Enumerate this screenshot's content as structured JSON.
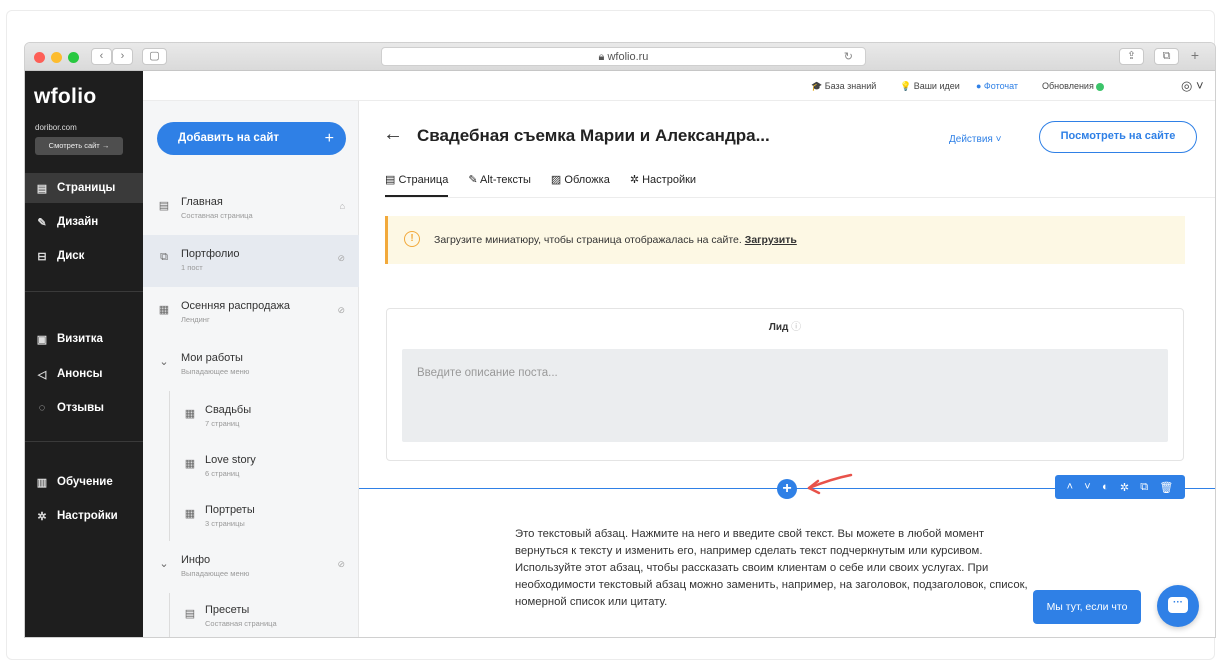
{
  "browser": {
    "url": "wfolio.ru",
    "back": "‹",
    "forward": "›",
    "sidebar_toggle": "▢",
    "share": "⇪",
    "tabs_btn": "⧉",
    "new_tab": "+"
  },
  "app": {
    "logo": "wfolio",
    "domain": "doribor.com",
    "view_site_btn": "Смотреть сайт →"
  },
  "sidebar": {
    "items": [
      {
        "label": "Страницы",
        "icon": "page-icon",
        "glyph": "▤"
      },
      {
        "label": "Дизайн",
        "icon": "brush-icon",
        "glyph": "✎"
      },
      {
        "label": "Диск",
        "icon": "disk-icon",
        "glyph": "⊟"
      },
      {
        "label": "Визитка",
        "icon": "card-icon",
        "glyph": "▣"
      },
      {
        "label": "Анонсы",
        "icon": "megaphone-icon",
        "glyph": "◁"
      },
      {
        "label": "Отзывы",
        "icon": "reviews-icon",
        "glyph": "◌"
      },
      {
        "label": "Обучение",
        "icon": "book-icon",
        "glyph": "▥"
      },
      {
        "label": "Настройки",
        "icon": "gear-icon",
        "glyph": "✲"
      }
    ]
  },
  "header": {
    "knowledge": "🎓 База знаний",
    "ideas": "💡 Ваши идеи",
    "fotochat": "● Фоточат",
    "updates": "Обновления",
    "user": "◎ ˅"
  },
  "pages_panel": {
    "add_button": "Добавить на сайт",
    "add_plus": "+",
    "items": [
      {
        "title": "Главная",
        "subtitle": "Составная страница"
      },
      {
        "title": "Портфолио",
        "subtitle": "1 пост"
      },
      {
        "title": "Осенняя распродажа",
        "subtitle": "Лендинг"
      },
      {
        "title": "Мои работы",
        "subtitle": "Выпадающее меню"
      },
      {
        "title": "Свадьбы",
        "subtitle": "7 страниц"
      },
      {
        "title": "Love story",
        "subtitle": "6 страниц"
      },
      {
        "title": "Портреты",
        "subtitle": "3 страницы"
      },
      {
        "title": "Инфо",
        "subtitle": "Выпадающее меню"
      },
      {
        "title": "Пресеты",
        "subtitle": "Составная страница"
      }
    ]
  },
  "main": {
    "back_arrow": "←",
    "title": "Свадебная съемка Марии и Александра...",
    "actions": "Действия ˅",
    "view_on_site": "Посмотреть на сайте",
    "tabs": [
      "Страница",
      "Alt-тексты",
      "Обложка",
      "Настройки"
    ],
    "warning_text": "Загрузите миниатюру, чтобы страница отображалась на сайте.",
    "warning_link": "Загрузить",
    "lead_label": "Лид",
    "lead_placeholder": "Введите описание поста...",
    "paragraph": "Это текстовый абзац. Нажмите на него и введите свой текст. Вы можете в любой момент вернуться к тексту и изменить его, например сделать текст подчеркнутым или курсивом. Используйте этот абзац, чтобы рассказать своим клиентам о себе или своих услугах. При необходимости текстовый абзац можно заменить, например, на заголовок, подзаголовок, список, номерной список или цитату.",
    "chat_pill": "Мы тут, если что"
  },
  "colors": {
    "accent": "#2f80e6",
    "sidebar_bg": "#1e1e1e",
    "warning_border": "#f2a93b",
    "online": "#3cc46a"
  }
}
